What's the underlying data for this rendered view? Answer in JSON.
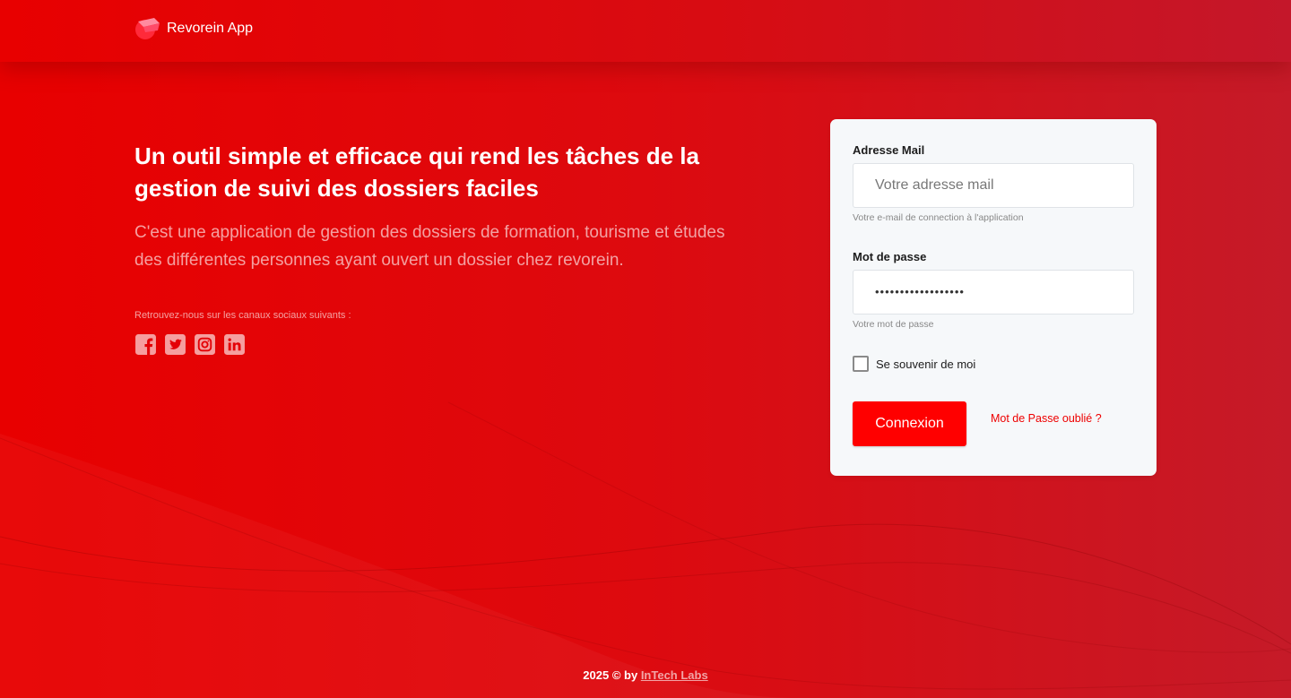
{
  "header": {
    "app_name": "Revorein App"
  },
  "hero": {
    "title": "Un outil simple et efficace qui rend les tâches de la gestion de suivi des dossiers faciles",
    "description": "C'est une application de gestion des dossiers de formation, tourisme et études des différentes personnes ayant ouvert un dossier chez revorein.",
    "social_caption": "Retrouvez-nous sur les canaux sociaux suivants :",
    "social_icons": [
      "facebook-icon",
      "twitter-icon",
      "instagram-icon",
      "linkedin-icon"
    ]
  },
  "login": {
    "email_label": "Adresse Mail",
    "email_placeholder": "Votre adresse mail",
    "email_hint": "Votre e-mail de connection à l'application",
    "password_label": "Mot de passe",
    "password_value": "••••••••••••••••••",
    "password_hint": "Votre mot de passe",
    "remember_label": "Se souvenir de moi",
    "submit_label": "Connexion",
    "forgot_label": "Mot de Passe oublié ?"
  },
  "footer": {
    "text": "2025 © by",
    "link": "InTech Labs"
  },
  "colors": {
    "primary": "#ff0000",
    "background": "#e00008",
    "card": "#f6f8fa"
  }
}
